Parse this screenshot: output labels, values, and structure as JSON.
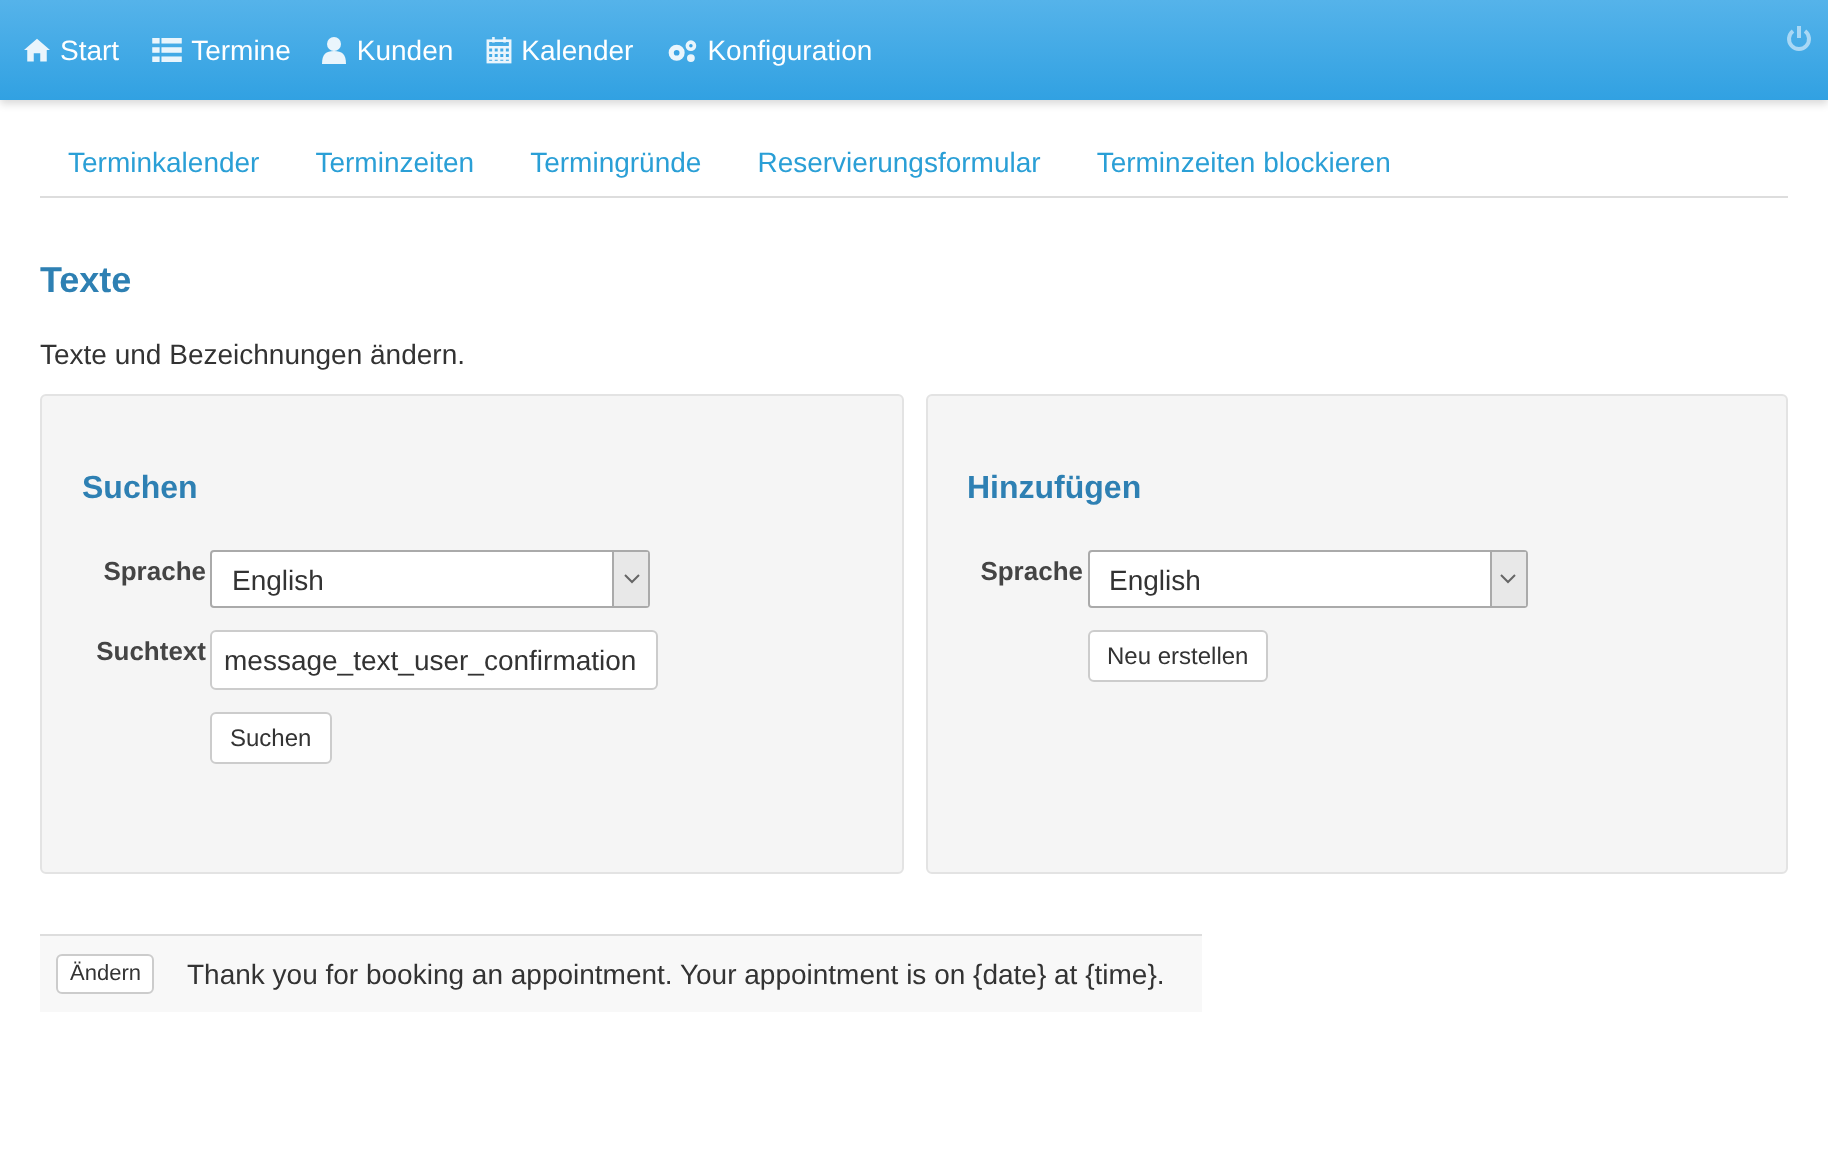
{
  "navbar": {
    "items": [
      {
        "label": "Start"
      },
      {
        "label": "Termine"
      },
      {
        "label": "Kunden"
      },
      {
        "label": "Kalender"
      },
      {
        "label": "Konfiguration"
      }
    ]
  },
  "subnav": {
    "items": [
      "Terminkalender",
      "Terminzeiten",
      "Termingründe",
      "Reservierungsformular",
      "Terminzeiten blockieren"
    ]
  },
  "page": {
    "title": "Texte",
    "description": "Texte und Bezeichnungen ändern."
  },
  "panels": [
    {
      "title": "Suchen",
      "fields": [
        {
          "kind": "select",
          "label": "Sprache",
          "value": "English"
        },
        {
          "kind": "text",
          "label": "Suchtext",
          "value": "message_text_user_confirmation"
        }
      ],
      "button": "Suchen"
    },
    {
      "title": "Hinzufügen",
      "fields": [
        {
          "kind": "select",
          "label": "Sprache",
          "value": "English"
        }
      ],
      "button": "Neu erstellen"
    }
  ],
  "results": [
    {
      "button": "Ändern",
      "text": "Thank you for booking an appointment. Your appointment is on {date} at {time}."
    }
  ]
}
